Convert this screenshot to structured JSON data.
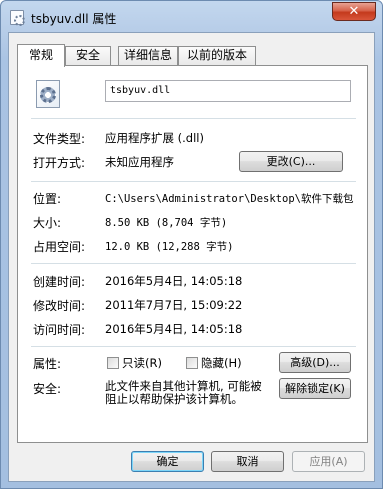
{
  "window": {
    "title": "tsbyuv.dll 属性",
    "close_label": "✕"
  },
  "tabs": [
    {
      "label": "常规",
      "active": true
    },
    {
      "label": "安全",
      "active": false
    },
    {
      "label": "详细信息",
      "active": false
    },
    {
      "label": "以前的版本",
      "active": false
    }
  ],
  "general": {
    "filename": "tsbyuv.dll",
    "file_type_label": "文件类型:",
    "file_type_value": "应用程序扩展 (.dll)",
    "open_with_label": "打开方式:",
    "open_with_value": "未知应用程序",
    "change_button": "更改(C)...",
    "location_label": "位置:",
    "location_value": "C:\\Users\\Administrator\\Desktop\\软件下载包",
    "size_label": "大小:",
    "size_value": "8.50 KB (8,704 字节)",
    "size_on_disk_label": "占用空间:",
    "size_on_disk_value": "12.0 KB (12,288 字节)",
    "created_label": "创建时间:",
    "created_value": "2016年5月4日, 14:05:18",
    "modified_label": "修改时间:",
    "modified_value": "2011年7月7日, 15:09:22",
    "accessed_label": "访问时间:",
    "accessed_value": "2016年5月4日, 14:05:18",
    "attributes_label": "属性:",
    "readonly_label": "只读(R)",
    "hidden_label": "隐藏(H)",
    "advanced_button": "高级(D)...",
    "security_label": "安全:",
    "security_text": "此文件来自其他计算机, 可能被阻止以帮助保护该计算机。",
    "unblock_button": "解除锁定(K)"
  },
  "footer": {
    "ok_button": "确定",
    "cancel_button": "取消",
    "apply_button": "应用(A)"
  },
  "icons": {
    "title_icon": "dll-file-icon",
    "file_icon": "dll-gear-file-icon"
  }
}
